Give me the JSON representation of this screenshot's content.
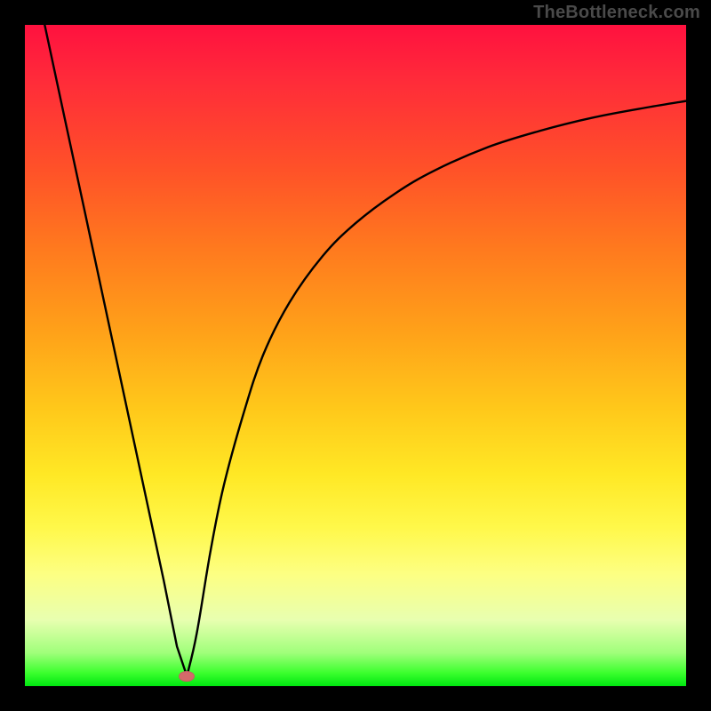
{
  "watermark": "TheBottleneck.com",
  "colors": {
    "background": "#000000",
    "curve": "#000000",
    "marker": "#d46a6a"
  },
  "chart_data": {
    "type": "line",
    "title": "",
    "xlabel": "",
    "ylabel": "",
    "xlim": [
      0,
      100
    ],
    "ylim": [
      0,
      100
    ],
    "grid": false,
    "annotations": [
      {
        "type": "marker",
        "x": 24.5,
        "y": 1.5,
        "shape": "ellipse",
        "color": "#d46a6a"
      }
    ],
    "series": [
      {
        "name": "left-descent",
        "x": [
          3,
          6,
          9,
          12,
          15,
          18,
          21,
          23,
          24.5
        ],
        "y": [
          100,
          86,
          72,
          58,
          44,
          30,
          16,
          6,
          1.5
        ]
      },
      {
        "name": "right-ascent",
        "x": [
          24.5,
          26,
          28,
          30,
          33,
          36,
          40,
          45,
          50,
          56,
          62,
          70,
          78,
          86,
          94,
          100
        ],
        "y": [
          1.5,
          8,
          20,
          30,
          41,
          50,
          58,
          65,
          70,
          74.5,
          78,
          81.5,
          84,
          86,
          87.5,
          88.5
        ]
      }
    ],
    "background_gradient": {
      "direction": "top-to-bottom",
      "stops": [
        {
          "pos": 0,
          "color": "#ff113f"
        },
        {
          "pos": 22,
          "color": "#ff5228"
        },
        {
          "pos": 46,
          "color": "#ffa019"
        },
        {
          "pos": 68,
          "color": "#ffe825"
        },
        {
          "pos": 90,
          "color": "#e8ffb0"
        },
        {
          "pos": 100,
          "color": "#00e710"
        }
      ]
    }
  }
}
